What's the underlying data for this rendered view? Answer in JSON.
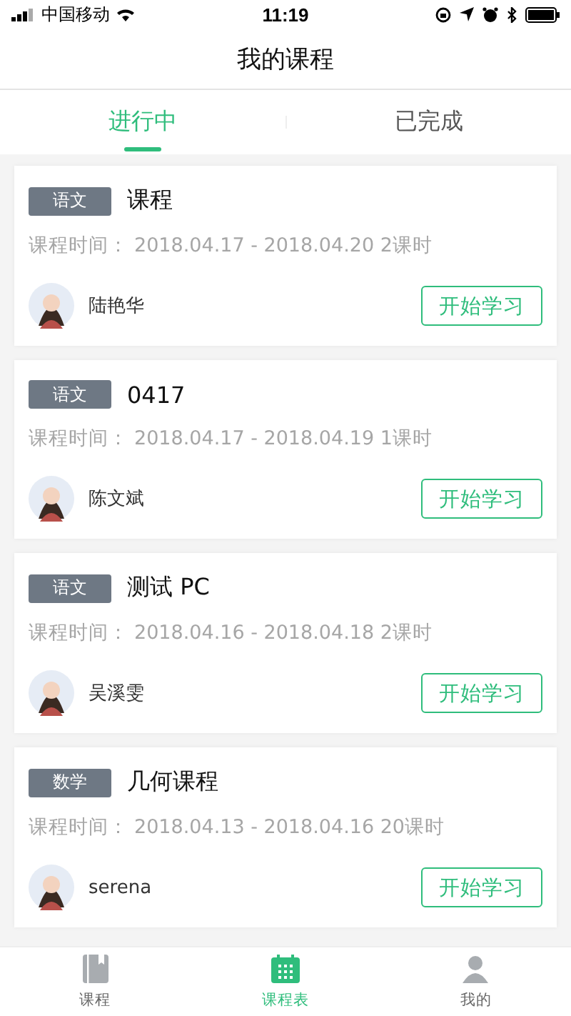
{
  "status_bar": {
    "carrier": "中国移动",
    "time": "11:19"
  },
  "header": {
    "title": "我的课程"
  },
  "tabs": [
    {
      "label": "进行中",
      "selected": true
    },
    {
      "label": "已完成",
      "selected": false
    }
  ],
  "courses": [
    {
      "subject": "语文",
      "title": "课程",
      "time_label": "课程时间：",
      "time": "2018.04.17 - 2018.04.20 2课时",
      "teacher": "陆艳华",
      "button": "开始学习"
    },
    {
      "subject": "语文",
      "title": "0417",
      "time_label": "课程时间：",
      "time": "2018.04.17 - 2018.04.19 1课时",
      "teacher": "陈文斌",
      "button": "开始学习"
    },
    {
      "subject": "语文",
      "title": "测试 PC",
      "time_label": "课程时间：",
      "time": "2018.04.16 - 2018.04.18 2课时",
      "teacher": "吴溪雯",
      "button": "开始学习"
    },
    {
      "subject": "数学",
      "title": "几何课程",
      "time_label": "课程时间：",
      "time": "2018.04.13 - 2018.04.16 20课时",
      "teacher": "serena",
      "button": "开始学习"
    }
  ],
  "bottom_nav": [
    {
      "label": "课程",
      "kind": "book",
      "selected": false
    },
    {
      "label": "课程表",
      "kind": "calendar",
      "selected": true
    },
    {
      "label": "我的",
      "kind": "person",
      "selected": false
    }
  ]
}
